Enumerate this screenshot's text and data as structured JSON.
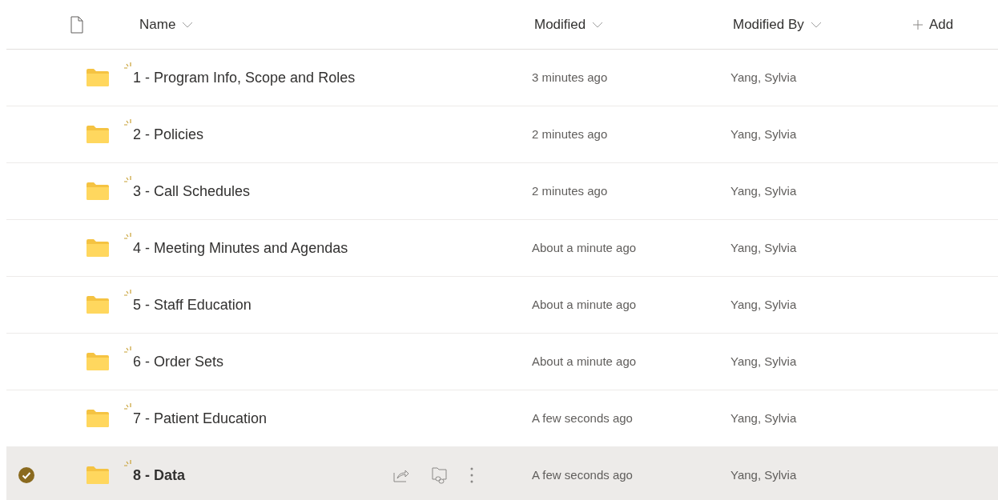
{
  "columns": [
    {
      "label": "Name"
    },
    {
      "label": "Modified"
    },
    {
      "label": "Modified By"
    }
  ],
  "add_column": {
    "label": "Add"
  },
  "rows": [
    {
      "name": "1 - Program Info, Scope and Roles",
      "modified": "3 minutes ago",
      "modified_by": "Yang, Sylvia",
      "selected": false
    },
    {
      "name": "2 - Policies",
      "modified": "2 minutes ago",
      "modified_by": "Yang, Sylvia",
      "selected": false
    },
    {
      "name": "3 - Call Schedules",
      "modified": "2 minutes ago",
      "modified_by": "Yang, Sylvia",
      "selected": false
    },
    {
      "name": "4 - Meeting Minutes and Agendas",
      "modified": "About a minute ago",
      "modified_by": "Yang, Sylvia",
      "selected": false
    },
    {
      "name": "5 - Staff Education",
      "modified": "About a minute ago",
      "modified_by": "Yang, Sylvia",
      "selected": false
    },
    {
      "name": "6 - Order Sets",
      "modified": "About a minute ago",
      "modified_by": "Yang, Sylvia",
      "selected": false
    },
    {
      "name": "7 - Patient Education",
      "modified": "A few seconds ago",
      "modified_by": "Yang, Sylvia",
      "selected": false
    },
    {
      "name": "8 - Data",
      "modified": "A few seconds ago",
      "modified_by": "Yang, Sylvia",
      "selected": true
    }
  ]
}
